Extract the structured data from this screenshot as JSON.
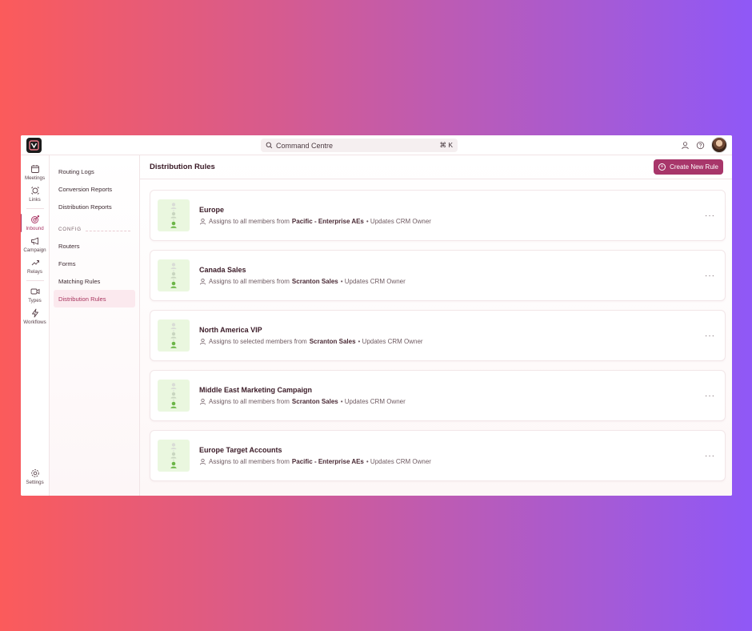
{
  "topbar": {
    "search_label": "Command Centre",
    "search_shortcut": "⌘ K"
  },
  "rail": {
    "items": [
      {
        "label": "Meetings"
      },
      {
        "label": "Links"
      },
      {
        "label": "Inbound"
      },
      {
        "label": "Campaign"
      },
      {
        "label": "Relays"
      },
      {
        "label": "Types"
      },
      {
        "label": "Workflows"
      }
    ],
    "settings_label": "Settings"
  },
  "nav": {
    "items": [
      "Routing Logs",
      "Conversion Reports",
      "Distribution Reports"
    ],
    "section_label": "CONFIG",
    "config_items": [
      "Routers",
      "Forms",
      "Matching Rules",
      "Distribution Rules"
    ]
  },
  "main": {
    "title": "Distribution Rules",
    "create_label": "Create New Rule"
  },
  "rules": [
    {
      "title": "Europe",
      "prefix": "Assigns to all members from",
      "team": "Pacific - Enterprise AEs",
      "suffix": "•  Updates CRM Owner"
    },
    {
      "title": "Canada Sales",
      "prefix": "Assigns to all members from",
      "team": "Scranton Sales",
      "suffix": "•  Updates CRM Owner"
    },
    {
      "title": "North America VIP",
      "prefix": "Assigns to selected members from",
      "team": "Scranton Sales",
      "suffix": "•  Updates CRM Owner"
    },
    {
      "title": "Middle East Marketing Campaign",
      "prefix": "Assigns to all members from",
      "team": "Scranton Sales",
      "suffix": "•  Updates CRM Owner"
    },
    {
      "title": "Europe Target Accounts",
      "prefix": "Assigns to all members from",
      "team": "Pacific - Enterprise AEs",
      "suffix": "•  Updates CRM Owner"
    }
  ],
  "colors": {
    "accent": "#a8366a",
    "thumb_bg": "#eaf7df",
    "active_nav_bg": "#fbe9ee"
  }
}
